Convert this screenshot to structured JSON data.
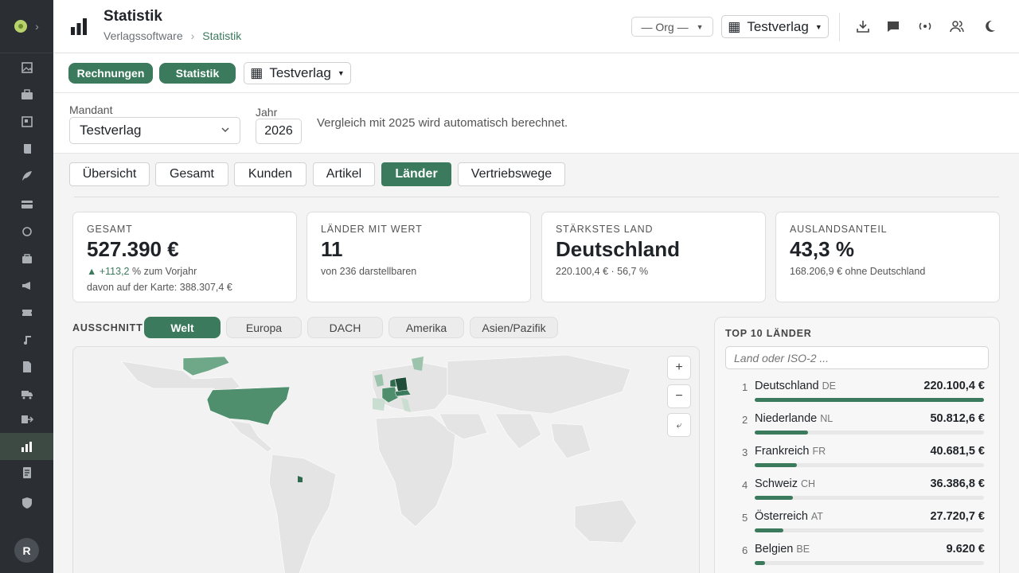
{
  "header": {
    "title": "Statistik",
    "breadcrumb": [
      "Verlagssoftware",
      "Statistik"
    ],
    "org_select": "— Org —",
    "tenant_select": "Testverlag"
  },
  "subbar": {
    "pills": [
      "Rechnungen",
      "Statistik"
    ],
    "tenant": "Testverlag"
  },
  "filters": {
    "mandant_label": "Mandant",
    "mandant_value": "Testverlag",
    "jahr_label": "Jahr",
    "jahr_value": "2026",
    "hint": "Vergleich mit 2025 wird automatisch berechnet."
  },
  "tabs": [
    "Übersicht",
    "Gesamt",
    "Kunden",
    "Artikel",
    "Länder",
    "Vertriebswege"
  ],
  "active_tab": "Länder",
  "kpis": [
    {
      "label": "GESAMT",
      "value": "527.390 €",
      "delta": "+113,2",
      "delta_suffix": " % zum Vorjahr",
      "sub2": "davon auf der Karte: 388.307,4 €"
    },
    {
      "label": "LÄNDER MIT WERT",
      "value": "11",
      "sub": "von 236 darstellbaren"
    },
    {
      "label": "STÄRKSTES LAND",
      "value": "Deutschland",
      "sub": "220.100,4 € · 56,7 %"
    },
    {
      "label": "AUSLANDSANTEIL",
      "value": "43,3 %",
      "sub": "168.206,9 € ohne Deutschland"
    }
  ],
  "ausschnitt": {
    "label": "AUSSCHNITT",
    "options": [
      "Welt",
      "Europa",
      "DACH",
      "Amerika",
      "Asien/Pazifik"
    ],
    "active": "Welt"
  },
  "map_controls": {
    "zoom_in": "+",
    "zoom_out": "−",
    "reset": "⤶"
  },
  "top10": {
    "title": "TOP 10 LÄNDER",
    "search_placeholder": "Land oder ISO-2 ...",
    "rows": [
      {
        "rank": "1",
        "name": "Deutschland",
        "iso": "DE",
        "value": "220.100,4 €",
        "share": 1.0
      },
      {
        "rank": "2",
        "name": "Niederlande",
        "iso": "NL",
        "value": "50.812,6 €",
        "share": 0.231
      },
      {
        "rank": "3",
        "name": "Frankreich",
        "iso": "FR",
        "value": "40.681,5 €",
        "share": 0.185
      },
      {
        "rank": "4",
        "name": "Schweiz",
        "iso": "CH",
        "value": "36.386,8 €",
        "share": 0.165
      },
      {
        "rank": "5",
        "name": "Österreich",
        "iso": "AT",
        "value": "27.720,7 €",
        "share": 0.126
      },
      {
        "rank": "6",
        "name": "Belgien",
        "iso": "BE",
        "value": "9.620 €",
        "share": 0.044
      }
    ]
  },
  "sidebar": {
    "avatar": "R",
    "icons": [
      "image-icon",
      "briefcase-icon",
      "board-icon",
      "scroll-icon",
      "feather-icon",
      "card-icon",
      "refresh-icon",
      "bag-icon",
      "megaphone-icon",
      "ticket-icon",
      "music-icon",
      "document-icon",
      "truck-icon",
      "forward-icon",
      "chart-icon",
      "receipt-icon",
      "shield-icon"
    ],
    "active_icon": "chart-icon"
  },
  "colors": {
    "accent": "#3b7a5d",
    "sidebar": "#2b2f33"
  }
}
